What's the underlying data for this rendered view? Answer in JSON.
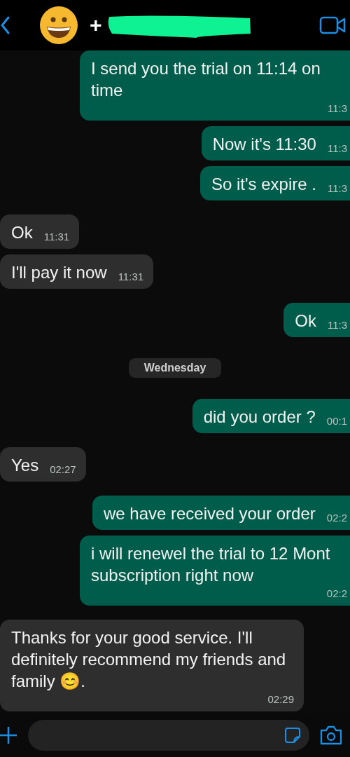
{
  "header": {
    "name_prefix": "+"
  },
  "messages": [
    {
      "kind": "sent",
      "text": "I send you the trial on 11:14 on time",
      "time": "11:3"
    },
    {
      "kind": "sent",
      "text": "Now it's 11:30",
      "time": "11:3"
    },
    {
      "kind": "sent",
      "text": "So it's expire .",
      "time": "11:3"
    },
    {
      "kind": "received",
      "text": "Ok",
      "time": "11:31"
    },
    {
      "kind": "received",
      "text": "I'll pay it now",
      "time": "11:31"
    },
    {
      "kind": "sent",
      "text": "Ok",
      "time": "11:3"
    },
    {
      "kind": "date",
      "text": "Wednesday"
    },
    {
      "kind": "sent",
      "text": "did you order ?",
      "time": "00:1"
    },
    {
      "kind": "received",
      "text": "Yes",
      "time": "02:27"
    },
    {
      "kind": "sent",
      "text": "we have received your order",
      "time": "02:2"
    },
    {
      "kind": "sent",
      "text": "i will renewel the trial to 12 Mont subscription right now",
      "time": "02:2"
    },
    {
      "kind": "received",
      "text": "Thanks for your good service. I'll definitely recommend my friends and family 😊.",
      "time": "02:29"
    }
  ]
}
